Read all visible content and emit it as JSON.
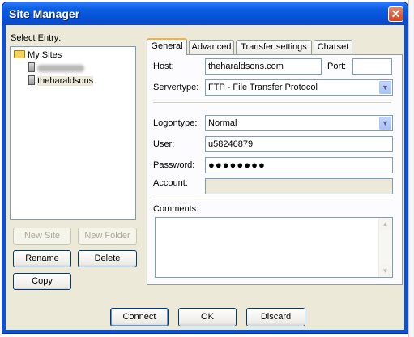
{
  "dialog": {
    "title": "Site Manager",
    "close_glyph": "✕"
  },
  "left": {
    "select_entry_label": "Select Entry:",
    "tree": {
      "root_label": "My Sites",
      "children": [
        {
          "label": "",
          "blurred": true
        },
        {
          "label": "theharaldsons",
          "selected": true
        }
      ]
    },
    "buttons": {
      "new_site": "New Site",
      "new_folder": "New Folder",
      "rename": "Rename",
      "delete": "Delete",
      "copy": "Copy"
    }
  },
  "tabs": [
    "General",
    "Advanced",
    "Transfer settings",
    "Charset"
  ],
  "general": {
    "host_label": "Host:",
    "host_value": "theharaldsons.com",
    "port_label": "Port:",
    "port_value": "",
    "servertype_label": "Servertype:",
    "servertype_value": "FTP - File Transfer Protocol",
    "logontype_label": "Logontype:",
    "logontype_value": "Normal",
    "user_label": "User:",
    "user_value": "u58246879",
    "password_label": "Password:",
    "password_value": "●●●●●●●●",
    "account_label": "Account:",
    "account_value": "",
    "comments_label": "Comments:",
    "comments_value": ""
  },
  "bottom": {
    "connect": "Connect",
    "ok": "OK",
    "discard": "Discard"
  },
  "colors": {
    "title_bar": "#0a52d8",
    "dialog_face": "#ece9d8",
    "close_button": "#d2451f",
    "active_tab_accent": "#f7b338"
  },
  "icons": {
    "root": "folder-icon",
    "site": "server-icon",
    "combo": "chevron-down-icon",
    "scroll_up": "triangle-up-icon",
    "scroll_down": "triangle-down-icon"
  }
}
